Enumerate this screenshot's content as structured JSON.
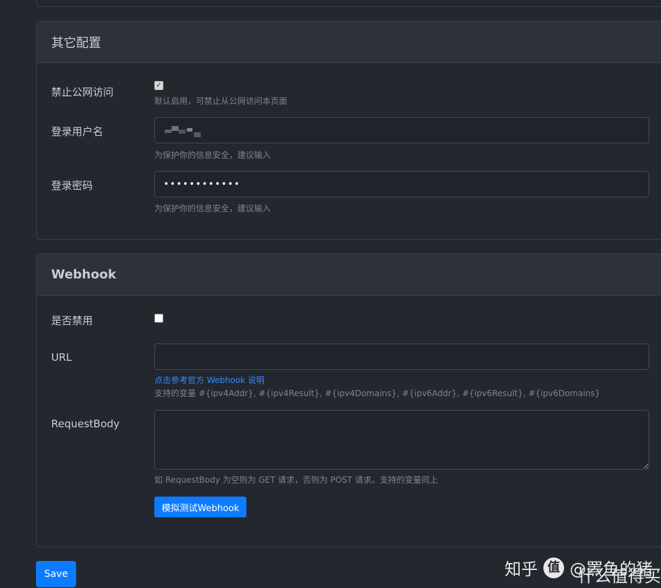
{
  "other_config": {
    "title": "其它配置",
    "disable_public": {
      "label": "禁止公网访问",
      "checked": true,
      "hint": "默认启用，可禁止从公网访问本页面"
    },
    "username": {
      "label": "登录用户名",
      "hint": "为保护你的信息安全，建议输入"
    },
    "password": {
      "label": "登录密码",
      "value": "••••••••••••",
      "hint": "为保护你的信息安全，建议输入"
    }
  },
  "webhook": {
    "title": "Webhook",
    "disabled": {
      "label": "是否禁用",
      "checked": false
    },
    "url": {
      "label": "URL",
      "value": "",
      "link": "点击参考官方 Webhook 说明",
      "hint": "支持的变量 #{ipv4Addr}, #{ipv4Result}, #{ipv4Domains}, #{ipv6Addr}, #{ipv6Result}, #{ipv6Domains}"
    },
    "request_body": {
      "label": "RequestBody",
      "value": "",
      "hint": "如 RequestBody 为空则为 GET 请求，否则为 POST 请求。支持的变量同上"
    },
    "test_button": "模拟测试Webhook"
  },
  "save_button": "Save",
  "watermark": {
    "site": "知乎",
    "author": "@罴鱼的猪",
    "overlay": "什么值得买",
    "logo_glyph": "值"
  }
}
